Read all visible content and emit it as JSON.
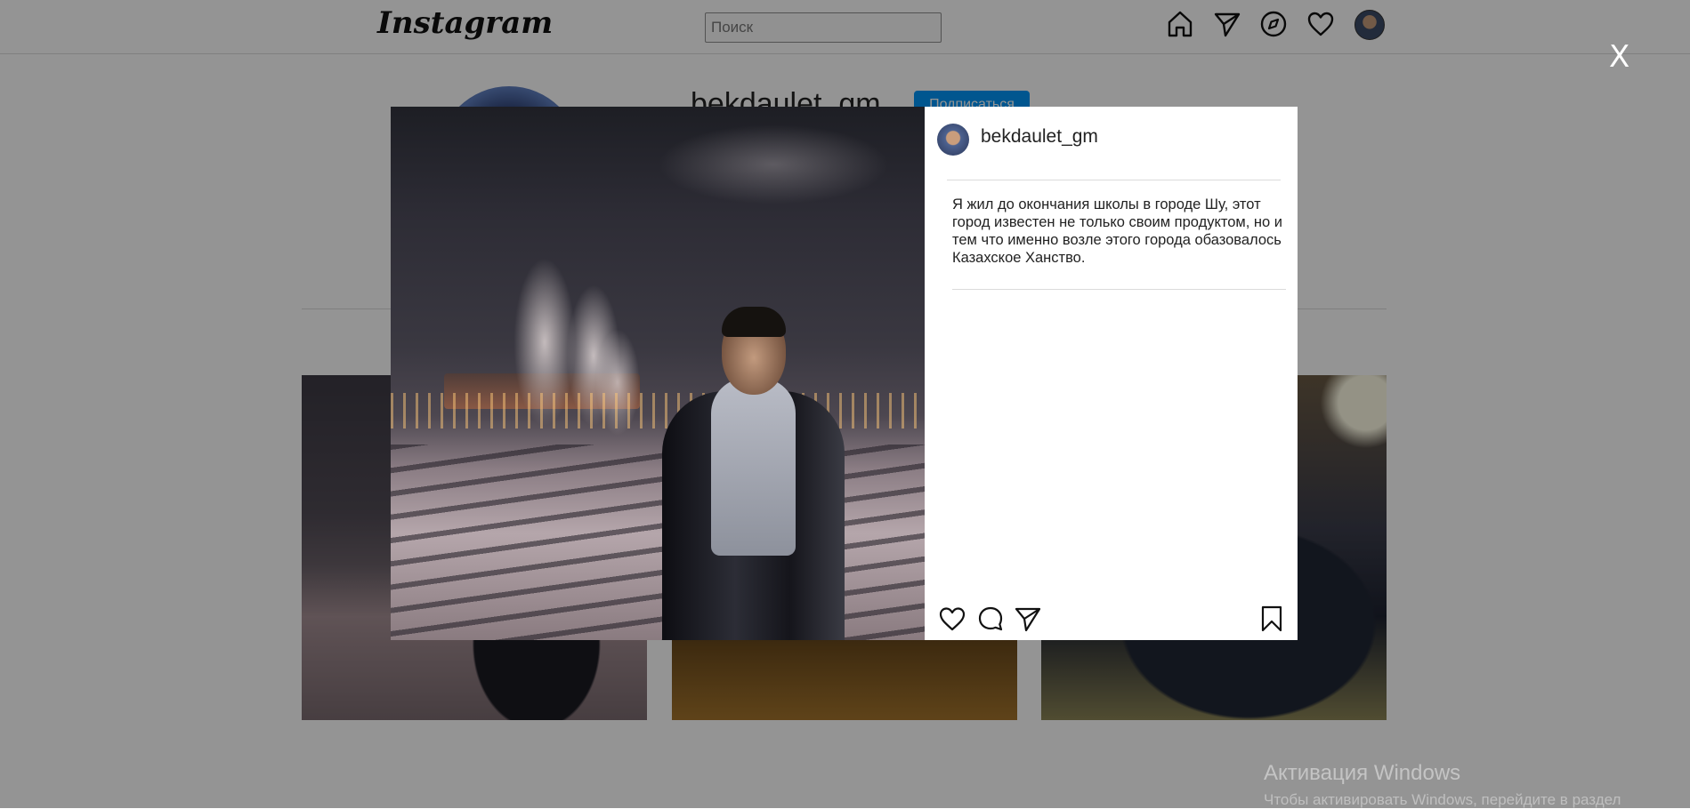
{
  "header": {
    "logo_text": "Instagram",
    "search_placeholder": "Поиск",
    "nav_icons": [
      "home-icon",
      "direct-icon",
      "explore-icon",
      "heart-icon"
    ]
  },
  "profile": {
    "username": "bekdaulet_gm",
    "follow_label": "Подписаться"
  },
  "modal": {
    "close_label": "X",
    "post": {
      "username": "bekdaulet_gm",
      "caption": "Я жил до окончания школы в городе Шу, этот город известен не только своим продуктом, но и тем что именно возле этого города обазовалось Казахское Ханство.",
      "actions": [
        "heart-icon",
        "comment-icon",
        "share-icon",
        "bookmark-icon"
      ]
    }
  },
  "watermark": {
    "title": "Активация Windows",
    "subtitle": "Чтобы активировать Windows, перейдите в раздел"
  },
  "colors": {
    "overlay": "rgba(0,0,0,0.42)",
    "follow_button": "#0095f6",
    "text": "#222222"
  }
}
